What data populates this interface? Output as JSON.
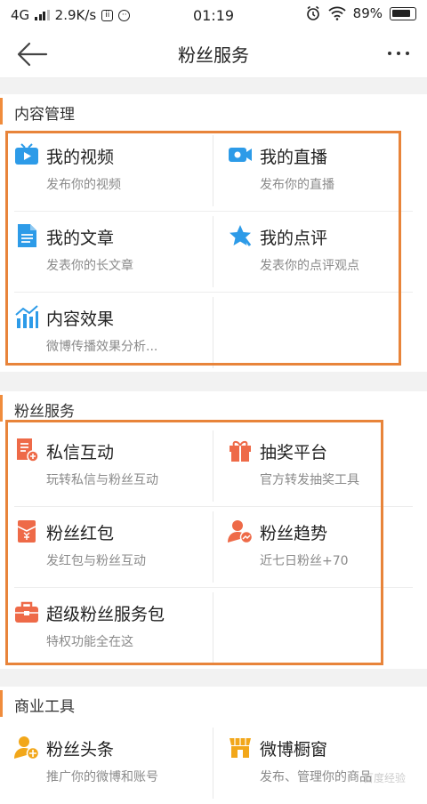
{
  "status": {
    "network": "4G",
    "speed": "2.9K/s",
    "time": "01:19",
    "battery": "89%",
    "icons": [
      "signal-icon",
      "square-app-icon",
      "chat-bubble-icon",
      "alarm-icon",
      "wifi-icon",
      "battery-icon"
    ]
  },
  "nav": {
    "title": "粉丝服务",
    "back_icon": "back-arrow-icon",
    "more_icon": "more-dots-icon"
  },
  "sections": [
    {
      "title": "内容管理",
      "items": [
        {
          "label": "我的视频",
          "sub": "发布你的视频",
          "icon": "video-icon",
          "color": "#2d9be8"
        },
        {
          "label": "我的直播",
          "sub": "发布你的直播",
          "icon": "live-camera-icon",
          "color": "#2d9be8"
        },
        {
          "label": "我的文章",
          "sub": "发表你的长文章",
          "icon": "document-icon",
          "color": "#2d9be8"
        },
        {
          "label": "我的点评",
          "sub": "发表你的点评观点",
          "icon": "star-review-icon",
          "color": "#2d9be8"
        },
        {
          "label": "内容效果",
          "sub": "微博传播效果分析...",
          "icon": "chart-icon",
          "color": "#2d9be8"
        }
      ]
    },
    {
      "title": "粉丝服务",
      "items": [
        {
          "label": "私信互动",
          "sub": "玩转私信与粉丝互动",
          "icon": "message-icon",
          "color": "#ee6a48"
        },
        {
          "label": "抽奖平台",
          "sub": "官方转发抽奖工具",
          "icon": "gift-icon",
          "color": "#ee6a48"
        },
        {
          "label": "粉丝红包",
          "sub": "发红包与粉丝互动",
          "icon": "red-envelope-icon",
          "color": "#ee6a48"
        },
        {
          "label": "粉丝趋势",
          "sub": "近七日粉丝+70",
          "icon": "fans-trend-icon",
          "color": "#ee6a48"
        },
        {
          "label": "超级粉丝服务包",
          "sub": "特权功能全在这",
          "icon": "briefcase-icon",
          "color": "#ee6a48"
        }
      ]
    },
    {
      "title": "商业工具",
      "items": [
        {
          "label": "粉丝头条",
          "sub": "推广你的微博和账号",
          "icon": "promote-user-icon",
          "color": "#f2a71a"
        },
        {
          "label": "微博橱窗",
          "sub": "发布、管理你的商品",
          "icon": "shop-window-icon",
          "color": "#f2a71a"
        }
      ]
    }
  ],
  "watermark": "百度经验"
}
